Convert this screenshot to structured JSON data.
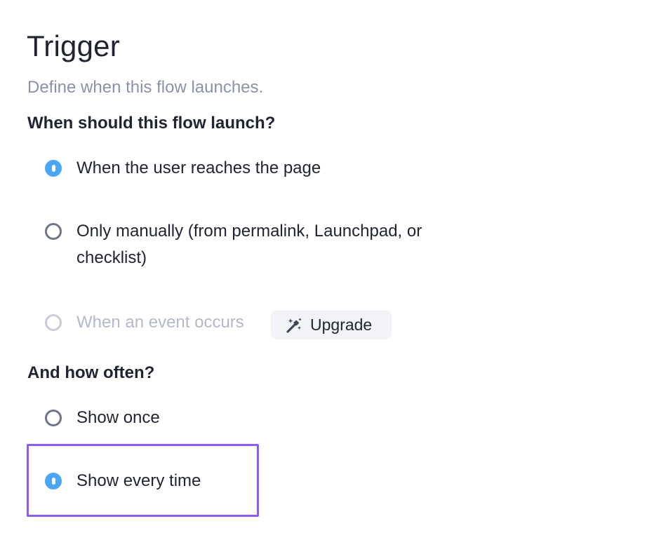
{
  "header": {
    "title": "Trigger",
    "subtitle": "Define when this flow launches."
  },
  "launch": {
    "question": "When should this flow launch?",
    "options": [
      {
        "label": "When the user reaches the page",
        "checked": true,
        "disabled": false
      },
      {
        "label": "Only manually (from permalink, Launchpad, or checklist)",
        "checked": false,
        "disabled": false
      },
      {
        "label": "When an event occurs",
        "checked": false,
        "disabled": true
      }
    ],
    "upgrade": {
      "label": "Upgrade",
      "icon": "magic-wand-icon"
    }
  },
  "frequency": {
    "question": "And how often?",
    "options": [
      {
        "label": "Show once",
        "checked": false,
        "disabled": false
      },
      {
        "label": "Show every time",
        "checked": true,
        "disabled": false
      }
    ]
  },
  "colors": {
    "accent": "#4aa6f5",
    "highlight": "#8b5cf6",
    "subtle_text": "#8a92a8",
    "disabled_text": "#b4b9c8"
  }
}
